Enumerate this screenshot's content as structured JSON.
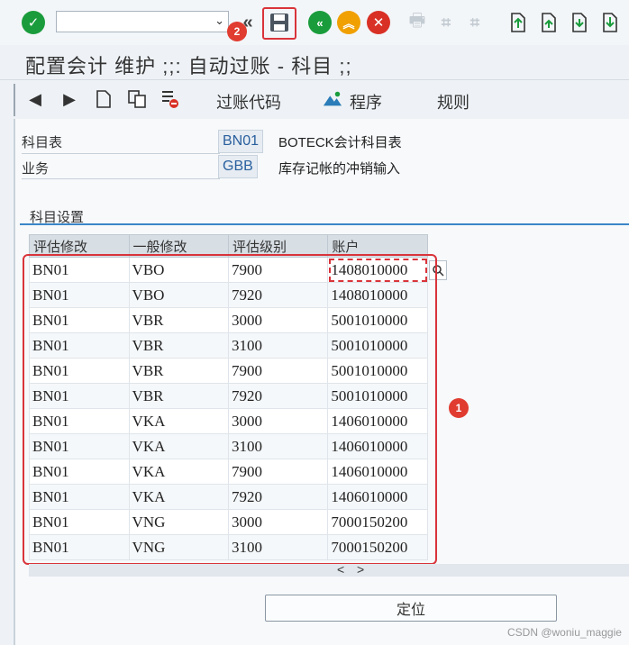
{
  "toolbar": {
    "command_field": {
      "value": "",
      "placeholder": ""
    },
    "icons": [
      "check-icon",
      "save-icon",
      "back-icon",
      "exit-icon",
      "cancel-icon",
      "print-icon",
      "find-icon",
      "find-next-icon",
      "first-page-icon",
      "previous-page-icon",
      "next-page-icon",
      "last-page-icon"
    ]
  },
  "annotations": {
    "badge_1": "1",
    "badge_2": "2"
  },
  "window": {
    "title": "配置会计 维护 ;;: 自动过账 - 科目 ;;"
  },
  "appbar": {
    "posting_key_label": "过账代码",
    "procedure_label": "程序",
    "rules_label": "规则"
  },
  "form": {
    "chart_of_accounts": {
      "label": "科目表",
      "value": "BN01",
      "description": "BOTECK会计科目表"
    },
    "transaction": {
      "label": "业务",
      "value": "GBB",
      "description": "库存记帐的冲销输入"
    }
  },
  "group": {
    "title": "科目设置"
  },
  "table": {
    "headers": [
      "评估修改",
      "一般修改",
      "评估级别",
      "账户"
    ],
    "rows": [
      [
        "BN01",
        "VBO",
        "7900",
        "1408010000"
      ],
      [
        "BN01",
        "VBO",
        "7920",
        "1408010000"
      ],
      [
        "BN01",
        "VBR",
        "3000",
        "5001010000"
      ],
      [
        "BN01",
        "VBR",
        "3100",
        "5001010000"
      ],
      [
        "BN01",
        "VBR",
        "7900",
        "5001010000"
      ],
      [
        "BN01",
        "VBR",
        "7920",
        "5001010000"
      ],
      [
        "BN01",
        "VKA",
        "3000",
        "1406010000"
      ],
      [
        "BN01",
        "VKA",
        "3100",
        "1406010000"
      ],
      [
        "BN01",
        "VKA",
        "7900",
        "1406010000"
      ],
      [
        "BN01",
        "VKA",
        "7920",
        "1406010000"
      ],
      [
        "BN01",
        "VNG",
        "3000",
        "7000150200"
      ],
      [
        "BN01",
        "VNG",
        "3100",
        "7000150200"
      ]
    ]
  },
  "scroll": {
    "left": "<",
    "right": ">"
  },
  "buttons": {
    "locate": "定位"
  },
  "watermark": "CSDN @woniu_maggie",
  "colors": {
    "accent": "#3a86c8",
    "highlight": "#d9343a",
    "green": "#1a9c3c",
    "orange": "#f0a000",
    "red": "#d93025"
  }
}
